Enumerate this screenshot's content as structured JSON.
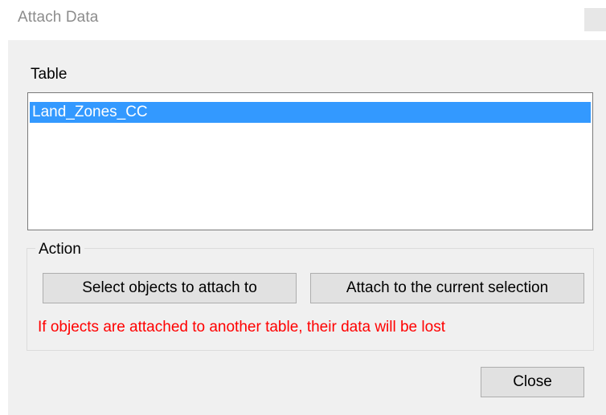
{
  "window": {
    "title": "Attach Data"
  },
  "table_section": {
    "label": "Table",
    "items": [
      {
        "label": "Land_Zones_CC",
        "selected": true
      }
    ]
  },
  "action_group": {
    "legend": "Action",
    "select_objects_label": "Select objects to attach to",
    "attach_current_label": "Attach to the current selection",
    "warning_text": "If objects are attached to another table, their data will be lost",
    "warning_color": "#ff0000"
  },
  "footer": {
    "close_label": "Close"
  },
  "colors": {
    "selection": "#3399ff",
    "dialog_background": "#f0f0f0",
    "button_face": "#e1e1e1"
  }
}
